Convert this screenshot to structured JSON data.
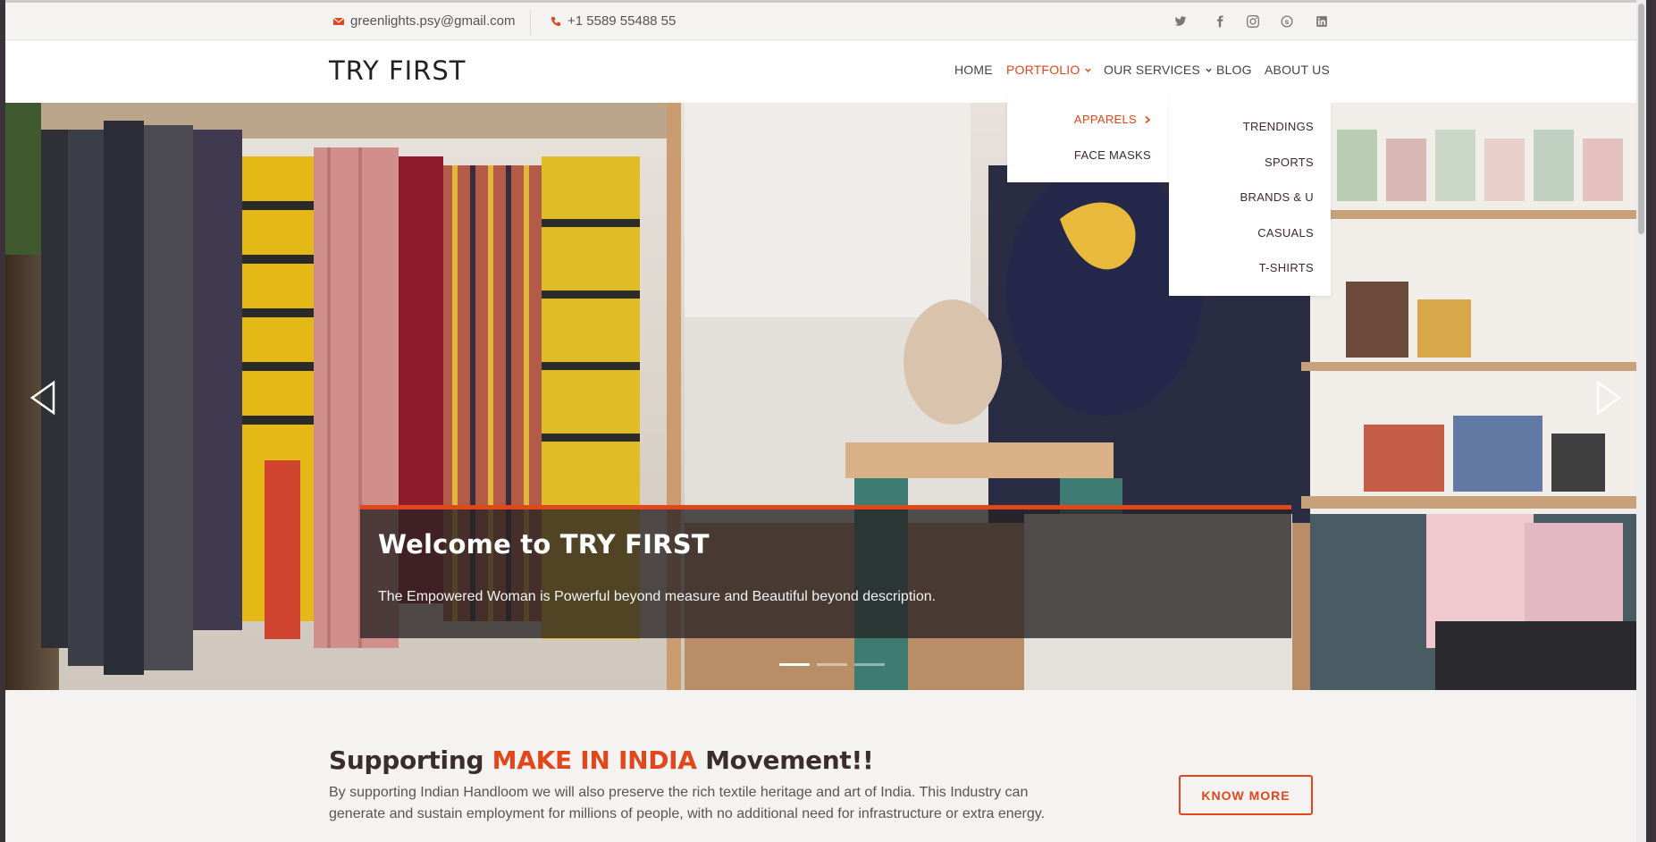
{
  "topbar": {
    "email": "greenlights.psy@gmail.com",
    "phone": "+1 5589 55488 55",
    "social": [
      "twitter-icon",
      "facebook-icon",
      "instagram-icon",
      "skype-icon",
      "linkedin-icon"
    ]
  },
  "header": {
    "logo": "TRY FIRST",
    "nav": {
      "home": "HOME",
      "portfolio": "PORTFOLIO",
      "services": "OUR SERVICES",
      "blog": "BLOG",
      "about": "ABOUT US"
    }
  },
  "portfolio_menu": {
    "apparels": "APPARELS",
    "face_masks": "FACE MASKS"
  },
  "apparels_menu": {
    "trendings": "TRENDINGS",
    "sports": "SPORTS",
    "brands": "BRANDS & U",
    "casuals": "CASUALS",
    "tshirts": "T-SHIRTS"
  },
  "hero": {
    "title": "Welcome to TRY FIRST",
    "subtitle": "The Empowered Woman is Powerful beyond measure and Beautiful beyond description.",
    "slide_count": 3,
    "active_slide": 1
  },
  "section": {
    "title_pre": "Supporting ",
    "title_highlight": "MAKE IN INDIA",
    "title_post": " Movement!!",
    "body": "By supporting Indian Handloom we will also preserve the rich textile heritage and art of India. This Industry can generate and sustain employment for millions of people, with no additional need for infrastructure or extra energy.",
    "button": "KNOW MORE"
  },
  "colors": {
    "accent": "#e2461b",
    "text_dark": "#3b2d2d"
  }
}
